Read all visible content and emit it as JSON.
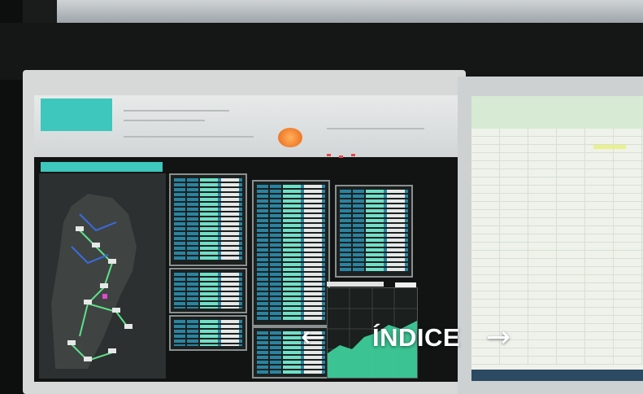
{
  "overlay": {
    "prev_arrow": "←",
    "label": "ÍNDICE",
    "next_arrow": "→"
  },
  "colors": {
    "accent_teal": "#3dc7bd",
    "logo_orange": "#f07b2b",
    "data_cyan": "#6fe0c8",
    "overlay_text": "#ffffff"
  },
  "icons": {
    "prev": "arrow-left-icon",
    "next": "arrow-right-icon"
  }
}
